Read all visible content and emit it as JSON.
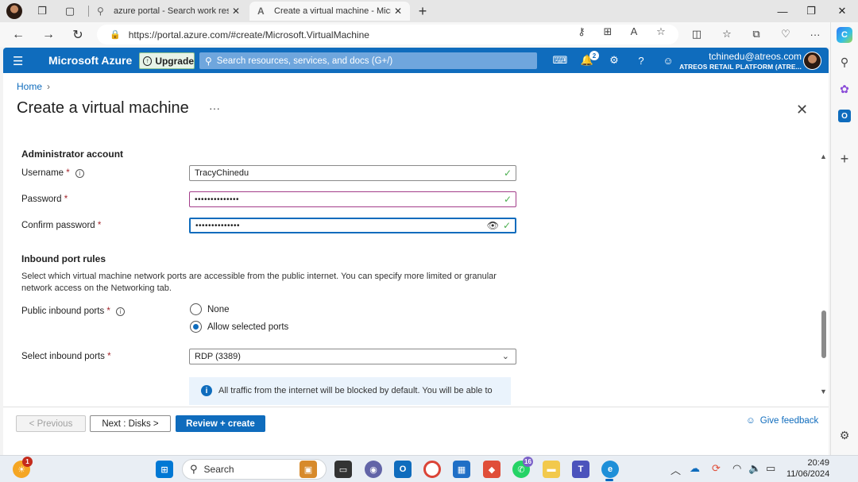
{
  "browser": {
    "tabs": [
      {
        "title": "azure portal - Search work result"
      },
      {
        "title": "Create a virtual machine - Micros"
      }
    ],
    "url": "https://portal.azure.com/#create/Microsoft.VirtualMachine"
  },
  "azure": {
    "brand": "Microsoft Azure",
    "upgrade_label": "Upgrade",
    "search_placeholder": "Search resources, services, and docs (G+/)",
    "notification_count": "2",
    "user_email": "tchinedu@atreos.com",
    "user_org": "ATREOS RETAIL PLATFORM (ATRE..."
  },
  "page": {
    "breadcrumb_home": "Home",
    "title": "Create a virtual machine",
    "more": "···",
    "admin": {
      "heading": "Administrator account",
      "username_label": "Username",
      "username_value": "TracyChinedu",
      "password_label": "Password",
      "password_value": "••••••••••••••",
      "confirm_label": "Confirm password",
      "confirm_value": "••••••••••••••"
    },
    "inbound": {
      "heading": "Inbound port rules",
      "description": "Select which virtual machine network ports are accessible from the public internet. You can specify more limited or granular network access on the Networking tab.",
      "public_ports_label": "Public inbound ports",
      "option_none": "None",
      "option_allow": "Allow selected ports",
      "selected_option": "Allow selected ports",
      "select_ports_label": "Select inbound ports",
      "select_ports_value": "RDP (3389)",
      "info_text": "All traffic from the internet will be blocked by default. You will be able to"
    },
    "footer": {
      "previous": "< Previous",
      "next": "Next : Disks >",
      "review": "Review + create",
      "feedback": "Give feedback"
    }
  },
  "taskbar": {
    "search_label": "Search",
    "weather_badge": "1",
    "whatsapp_badge": "16",
    "time": "20:49",
    "date": "11/06/2024"
  },
  "colors": {
    "azure_blue": "#0f6cbd",
    "required_red": "#a4262c",
    "valid_green": "#4caf50"
  }
}
